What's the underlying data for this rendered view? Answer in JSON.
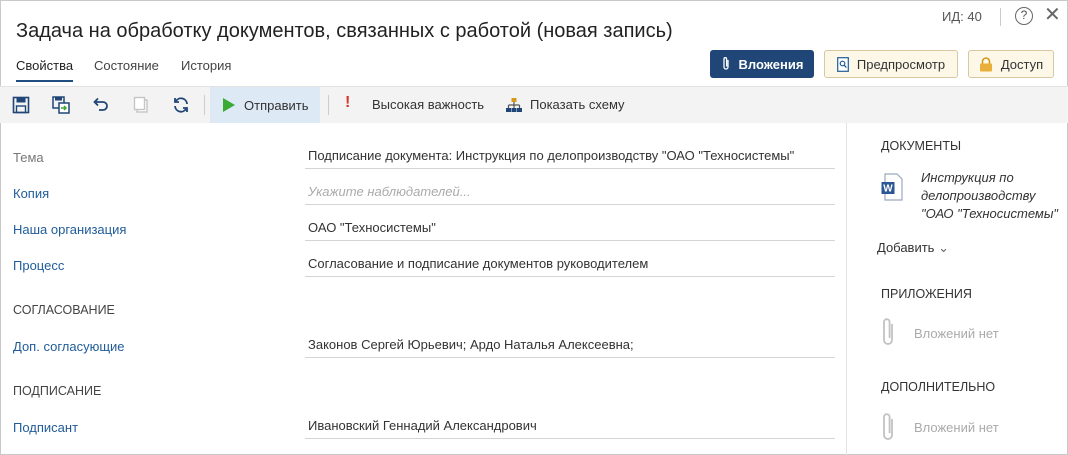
{
  "header": {
    "title": "Задача на обработку документов, связанных с работой (новая запись)",
    "id_label": "ИД: 40",
    "help_glyph": "?",
    "close_glyph": "✕"
  },
  "tabs": [
    {
      "label": "Свойства",
      "active": true
    },
    {
      "label": "Состояние",
      "active": false
    },
    {
      "label": "История",
      "active": false
    }
  ],
  "header_buttons": {
    "attachments": "Вложения",
    "preview": "Предпросмотр",
    "access": "Доступ"
  },
  "toolbar": {
    "send": "Отправить",
    "high_importance": "Высокая важность",
    "show_scheme": "Показать схему",
    "importance_glyph": "!"
  },
  "form": {
    "subject_label": "Тема",
    "subject_value": "Подписание документа: Инструкция по делопроизводству \"ОАО \"Техносистемы\"",
    "copy_label": "Копия",
    "copy_placeholder": "Укажите наблюдателей...",
    "org_label": "Наша организация",
    "org_value": "ОАО \"Техносистемы\"",
    "process_label": "Процесс",
    "process_value": "Согласование и подписание документов руководителем",
    "approval_section": "СОГЛАСОВАНИЕ",
    "approvers_label": "Доп. согласующие",
    "approvers_value": "Законов Сергей Юрьевич;  Ардо Наталья Алексеевна;",
    "signing_section": "ПОДПИСАНИЕ",
    "signer_label": "Подписант",
    "signer_value": "Ивановский Геннадий Александрович"
  },
  "right_panel": {
    "documents_head": "ДОКУМЕНТЫ",
    "document_name": "Инструкция по делопроизводству \"ОАО \"Техносистемы\"",
    "add_label": "Добавить",
    "add_chevron": "⌄",
    "attachments_head": "ПРИЛОЖЕНИЯ",
    "attachments_empty": "Вложений нет",
    "extra_head": "ДОПОЛНИТЕЛЬНО",
    "extra_empty": "Вложений нет"
  },
  "colors": {
    "accent_dark": "#1f4677",
    "link": "#1f5c99",
    "send_green": "#3aaa35",
    "importance_red": "#d9342b",
    "toolbar_bg": "#f3f3f3"
  },
  "icons": [
    "save-icon",
    "save-close-icon",
    "undo-icon",
    "copy-icon",
    "refresh-icon",
    "play-icon",
    "exclamation-icon",
    "scheme-icon",
    "paperclip-icon",
    "magnifier-doc-icon",
    "lock-icon",
    "word-doc-icon",
    "help-icon",
    "close-icon"
  ]
}
